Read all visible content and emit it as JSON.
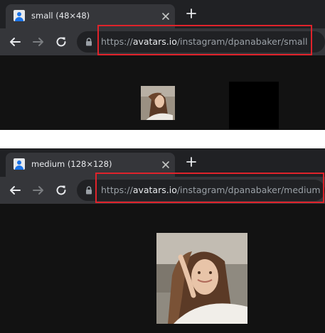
{
  "windows": [
    {
      "tab_title": "small (48×48)",
      "url_scheme": "https://",
      "url_host": "avatars.io",
      "url_path": "/instagram/dpanabaker/small"
    },
    {
      "tab_title": "medium (128×128)",
      "url_scheme": "https://",
      "url_host": "avatars.io",
      "url_path": "/instagram/dpanabaker/medium"
    }
  ],
  "icons": [
    "favicon-icon",
    "close-icon",
    "plus-icon",
    "back-arrow-icon",
    "forward-arrow-icon",
    "reload-icon",
    "lock-icon"
  ],
  "colors": {
    "highlight": "#e0232b",
    "tab_active": "#35363a",
    "tabstrip": "#202124",
    "page_background": "#121212"
  }
}
